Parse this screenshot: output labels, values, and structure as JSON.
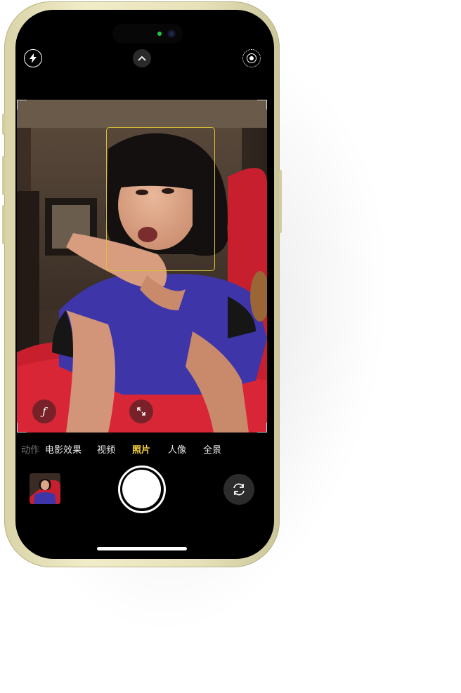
{
  "camera": {
    "top_bar": {
      "flash_icon": "flash-icon",
      "controls_icon": "chevron-up-icon",
      "live_photo_icon": "live-photo-icon"
    },
    "viewfinder": {
      "aperture_label": "ƒ",
      "expand_icon": "expand-arrows-icon"
    },
    "modes": [
      {
        "label": "动作",
        "state": "faded"
      },
      {
        "label": "电影效果",
        "state": "normal"
      },
      {
        "label": "视频",
        "state": "normal"
      },
      {
        "label": "照片",
        "state": "active"
      },
      {
        "label": "人像",
        "state": "normal"
      },
      {
        "label": "全景",
        "state": "normal"
      }
    ],
    "bottom_bar": {
      "last_photo_icon": "photo-thumbnail",
      "shutter_icon": "shutter-button",
      "flip_icon": "camera-flip-icon"
    }
  },
  "colors": {
    "active_mode": "#f5d33b",
    "face_box": "#d8c335",
    "phone_frame": "#e7e2b9"
  }
}
